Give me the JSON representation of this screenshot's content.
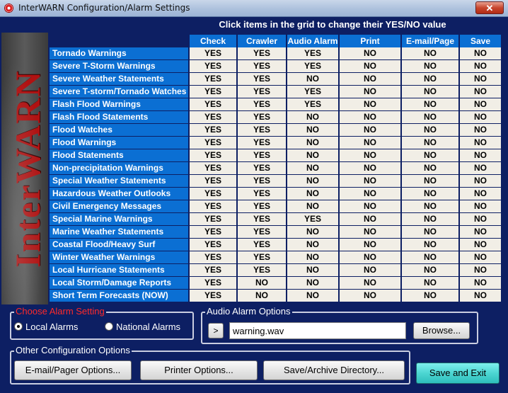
{
  "window": {
    "title": "InterWARN Configuration/Alarm Settings",
    "close_glyph": "✕"
  },
  "banner": {
    "text": "InterWARN"
  },
  "grid": {
    "hint": "Click items in the grid to change their YES/NO value",
    "columns": [
      "Check",
      "Crawler",
      "Audio Alarm",
      "Print",
      "E-mail/Page",
      "Save"
    ],
    "rows": [
      {
        "label": "Tornado Warnings",
        "values": [
          "YES",
          "YES",
          "YES",
          "NO",
          "NO",
          "NO"
        ]
      },
      {
        "label": "Severe T-Storm Warnings",
        "values": [
          "YES",
          "YES",
          "YES",
          "NO",
          "NO",
          "NO"
        ]
      },
      {
        "label": "Severe Weather Statements",
        "values": [
          "YES",
          "YES",
          "NO",
          "NO",
          "NO",
          "NO"
        ]
      },
      {
        "label": "Severe T-storm/Tornado Watches",
        "values": [
          "YES",
          "YES",
          "YES",
          "NO",
          "NO",
          "NO"
        ]
      },
      {
        "label": "Flash Flood Warnings",
        "values": [
          "YES",
          "YES",
          "YES",
          "NO",
          "NO",
          "NO"
        ]
      },
      {
        "label": "Flash Flood Statements",
        "values": [
          "YES",
          "YES",
          "NO",
          "NO",
          "NO",
          "NO"
        ]
      },
      {
        "label": "Flood Watches",
        "values": [
          "YES",
          "YES",
          "NO",
          "NO",
          "NO",
          "NO"
        ]
      },
      {
        "label": "Flood Warnings",
        "values": [
          "YES",
          "YES",
          "NO",
          "NO",
          "NO",
          "NO"
        ]
      },
      {
        "label": "Flood Statements",
        "values": [
          "YES",
          "YES",
          "NO",
          "NO",
          "NO",
          "NO"
        ]
      },
      {
        "label": "Non-precipitation Warnings",
        "values": [
          "YES",
          "YES",
          "NO",
          "NO",
          "NO",
          "NO"
        ]
      },
      {
        "label": "Special Weather Statements",
        "values": [
          "YES",
          "YES",
          "NO",
          "NO",
          "NO",
          "NO"
        ]
      },
      {
        "label": "Hazardous Weather Outlooks",
        "values": [
          "YES",
          "YES",
          "NO",
          "NO",
          "NO",
          "NO"
        ]
      },
      {
        "label": "Civil Emergency Messages",
        "values": [
          "YES",
          "YES",
          "NO",
          "NO",
          "NO",
          "NO"
        ]
      },
      {
        "label": "Special Marine Warnings",
        "values": [
          "YES",
          "YES",
          "YES",
          "NO",
          "NO",
          "NO"
        ]
      },
      {
        "label": "Marine Weather Statements",
        "values": [
          "YES",
          "YES",
          "NO",
          "NO",
          "NO",
          "NO"
        ]
      },
      {
        "label": "Coastal Flood/Heavy Surf",
        "values": [
          "YES",
          "YES",
          "NO",
          "NO",
          "NO",
          "NO"
        ]
      },
      {
        "label": "Winter Weather Warnings",
        "values": [
          "YES",
          "YES",
          "NO",
          "NO",
          "NO",
          "NO"
        ]
      },
      {
        "label": "Local Hurricane Statements",
        "values": [
          "YES",
          "YES",
          "NO",
          "NO",
          "NO",
          "NO"
        ]
      },
      {
        "label": "Local Storm/Damage Reports",
        "values": [
          "YES",
          "NO",
          "NO",
          "NO",
          "NO",
          "NO"
        ]
      },
      {
        "label": "Short Term Forecasts (NOW)",
        "values": [
          "YES",
          "NO",
          "NO",
          "NO",
          "NO",
          "NO"
        ]
      }
    ]
  },
  "alarm_setting": {
    "title": "Choose Alarm Setting",
    "local_label": "Local Alarms",
    "national_label": "National Alarms",
    "selected": "local"
  },
  "audio_options": {
    "title": "Audio Alarm Options",
    "play_glyph": ">",
    "file_value": "warning.wav",
    "browse_label": "Browse..."
  },
  "other_options": {
    "title": "Other Configuration Options",
    "email_label": "E-mail/Pager Options...",
    "printer_label": "Printer Options...",
    "archive_label": "Save/Archive Directory..."
  },
  "save_exit_label": "Save and Exit",
  "colors": {
    "header_blue": "#0b6fd3",
    "window_bg": "#0d1f63",
    "cell_bg": "#f1eee6",
    "alarm_title_red": "#ff2a2a",
    "save_button": "#4cd6d2"
  }
}
